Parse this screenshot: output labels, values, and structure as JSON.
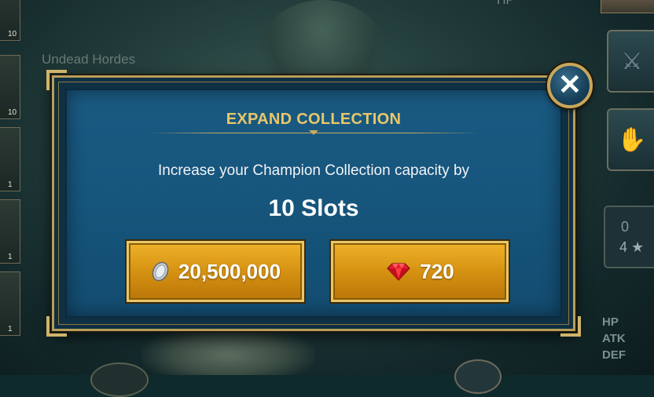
{
  "background": {
    "faction_label": "Undead Hordes",
    "top_stat_label": "HP",
    "champion_levels": [
      "10",
      "10",
      "1",
      "1",
      "1"
    ],
    "skill_count": "0",
    "stars": "4 ★",
    "stat_labels": [
      "HP",
      "ATK",
      "DEF"
    ]
  },
  "modal": {
    "title": "EXPAND COLLECTION",
    "description": "Increase your Champion Collection capacity by",
    "slots": "10 Slots",
    "silver_cost": "20,500,000",
    "gem_cost": "720",
    "close_icon": "close-icon"
  },
  "colors": {
    "gold_accent": "#e8c76a",
    "panel_blue": "#16557c",
    "button_gold": "#d38f10"
  }
}
